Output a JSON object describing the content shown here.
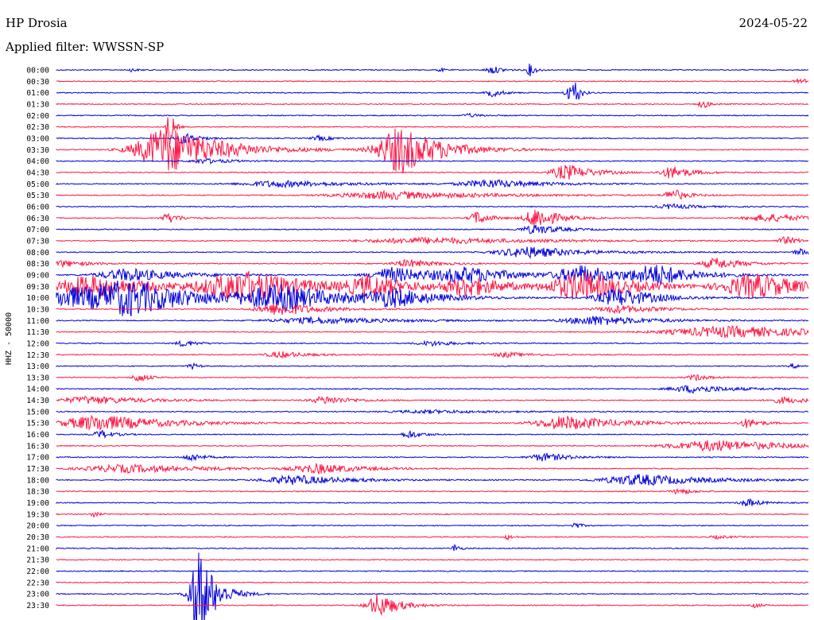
{
  "header": {
    "station": "HP Drosia",
    "date": "2024-05-22",
    "filter": "Applied filter: WWSSN-SP"
  },
  "chart_data": {
    "type": "line",
    "title": "HP Drosia",
    "ylabel": "HHZ - 50000",
    "colors": {
      "even": "#0000dd",
      "odd": "#ff1744"
    },
    "rows": [
      {
        "label": "00:00",
        "events": [
          {
            "t": 0.1,
            "a": 2,
            "w": 0.005
          },
          {
            "t": 0.51,
            "a": 3,
            "w": 0.003
          },
          {
            "t": 0.58,
            "a": 5,
            "w": 0.008
          },
          {
            "t": 0.63,
            "a": 8,
            "w": 0.004
          }
        ]
      },
      {
        "label": "00:30",
        "events": [
          {
            "t": 0.99,
            "a": 4,
            "w": 0.008
          }
        ]
      },
      {
        "label": "01:00",
        "events": [
          {
            "t": 0.58,
            "a": 5,
            "w": 0.008
          },
          {
            "t": 0.68,
            "a": 10,
            "w": 0.004
          },
          {
            "t": 0.69,
            "a": 14,
            "w": 0.004
          }
        ]
      },
      {
        "label": "01:30",
        "events": [
          {
            "t": 0.86,
            "a": 5,
            "w": 0.006
          }
        ]
      },
      {
        "label": "02:00",
        "events": [
          {
            "t": 0.55,
            "a": 2,
            "w": 0.01
          }
        ]
      },
      {
        "label": "02:30",
        "events": [
          {
            "t": 0.15,
            "a": 30,
            "w": 0.003
          }
        ]
      },
      {
        "label": "03:00",
        "events": [
          {
            "t": 0.17,
            "a": 8,
            "w": 0.01
          },
          {
            "t": 0.35,
            "a": 3,
            "w": 0.01
          }
        ]
      },
      {
        "label": "03:30",
        "events": [
          {
            "t": 0.15,
            "a": 30,
            "w": 0.04
          },
          {
            "t": 0.46,
            "a": 30,
            "w": 0.03
          }
        ]
      },
      {
        "label": "04:00",
        "events": [
          {
            "t": 0.2,
            "a": 3,
            "w": 0.02
          }
        ]
      },
      {
        "label": "04:30",
        "events": [
          {
            "t": 0.68,
            "a": 10,
            "w": 0.02
          },
          {
            "t": 0.82,
            "a": 8,
            "w": 0.015
          }
        ]
      },
      {
        "label": "05:00",
        "events": [
          {
            "t": 0.3,
            "a": 4,
            "w": 0.05
          },
          {
            "t": 0.58,
            "a": 5,
            "w": 0.04
          }
        ]
      },
      {
        "label": "05:30",
        "events": [
          {
            "t": 0.45,
            "a": 5,
            "w": 0.07
          },
          {
            "t": 0.82,
            "a": 8,
            "w": 0.01
          }
        ]
      },
      {
        "label": "06:00",
        "events": [
          {
            "t": 0.82,
            "a": 3,
            "w": 0.02
          }
        ]
      },
      {
        "label": "06:30",
        "events": [
          {
            "t": 0.15,
            "a": 6,
            "w": 0.01
          },
          {
            "t": 0.56,
            "a": 8,
            "w": 0.01
          },
          {
            "t": 0.64,
            "a": 14,
            "w": 0.015
          },
          {
            "t": 0.95,
            "a": 5,
            "w": 0.03
          }
        ]
      },
      {
        "label": "07:00",
        "events": [
          {
            "t": 0.64,
            "a": 6,
            "w": 0.02
          }
        ]
      },
      {
        "label": "07:30",
        "events": [
          {
            "t": 0.5,
            "a": 4,
            "w": 0.08
          },
          {
            "t": 0.97,
            "a": 5,
            "w": 0.01
          }
        ]
      },
      {
        "label": "08:00",
        "events": [
          {
            "t": 0.63,
            "a": 7,
            "w": 0.04
          },
          {
            "t": 0.99,
            "a": 4,
            "w": 0.01
          }
        ]
      },
      {
        "label": "08:30",
        "events": [
          {
            "t": 0.01,
            "a": 4,
            "w": 0.02
          },
          {
            "t": 0.47,
            "a": 5,
            "w": 0.02
          },
          {
            "t": 0.88,
            "a": 7,
            "w": 0.02
          }
        ]
      },
      {
        "label": "09:00",
        "events": [
          {
            "t": 0.1,
            "a": 8,
            "w": 0.04
          },
          {
            "t": 0.45,
            "a": 10,
            "w": 0.03
          },
          {
            "t": 0.55,
            "a": 9,
            "w": 0.04
          },
          {
            "t": 0.7,
            "a": 12,
            "w": 0.03
          },
          {
            "t": 0.8,
            "a": 12,
            "w": 0.03
          }
        ]
      },
      {
        "label": "09:30",
        "events": [
          {
            "t": 0.05,
            "a": 14,
            "w": 0.05
          },
          {
            "t": 0.25,
            "a": 20,
            "w": 0.05
          },
          {
            "t": 0.42,
            "a": 12,
            "w": 0.03
          },
          {
            "t": 0.55,
            "a": 12,
            "w": 0.03
          },
          {
            "t": 0.7,
            "a": 18,
            "w": 0.04
          },
          {
            "t": 0.93,
            "a": 16,
            "w": 0.04
          }
        ]
      },
      {
        "label": "10:00",
        "events": [
          {
            "t": 0.02,
            "a": 12,
            "w": 0.04
          },
          {
            "t": 0.1,
            "a": 20,
            "w": 0.05
          },
          {
            "t": 0.3,
            "a": 15,
            "w": 0.05
          },
          {
            "t": 0.45,
            "a": 10,
            "w": 0.03
          },
          {
            "t": 0.75,
            "a": 12,
            "w": 0.03
          }
        ]
      },
      {
        "label": "10:30",
        "events": [
          {
            "t": 0.3,
            "a": 8,
            "w": 0.03
          },
          {
            "t": 0.75,
            "a": 5,
            "w": 0.03
          }
        ]
      },
      {
        "label": "11:00",
        "events": [
          {
            "t": 0.35,
            "a": 4,
            "w": 0.06
          },
          {
            "t": 0.72,
            "a": 6,
            "w": 0.04
          }
        ]
      },
      {
        "label": "11:30",
        "events": [
          {
            "t": 0.9,
            "a": 7,
            "w": 0.08
          }
        ]
      },
      {
        "label": "12:00",
        "events": [
          {
            "t": 0.17,
            "a": 4,
            "w": 0.01
          },
          {
            "t": 0.5,
            "a": 3,
            "w": 0.02
          }
        ]
      },
      {
        "label": "12:30",
        "events": [
          {
            "t": 0.3,
            "a": 4,
            "w": 0.02
          },
          {
            "t": 0.6,
            "a": 3,
            "w": 0.02
          }
        ]
      },
      {
        "label": "13:00",
        "events": [
          {
            "t": 0.18,
            "a": 4,
            "w": 0.005
          },
          {
            "t": 0.98,
            "a": 3,
            "w": 0.005
          }
        ]
      },
      {
        "label": "13:30",
        "events": [
          {
            "t": 0.11,
            "a": 6,
            "w": 0.008
          },
          {
            "t": 0.85,
            "a": 4,
            "w": 0.01
          }
        ]
      },
      {
        "label": "14:00",
        "events": [
          {
            "t": 0.85,
            "a": 5,
            "w": 0.03
          }
        ]
      },
      {
        "label": "14:30",
        "events": [
          {
            "t": 0.05,
            "a": 5,
            "w": 0.04
          },
          {
            "t": 0.36,
            "a": 5,
            "w": 0.02
          },
          {
            "t": 0.97,
            "a": 4,
            "w": 0.02
          }
        ]
      },
      {
        "label": "15:00",
        "events": [
          {
            "t": 0.5,
            "a": 2,
            "w": 0.05
          }
        ]
      },
      {
        "label": "15:30",
        "events": [
          {
            "t": 0.06,
            "a": 10,
            "w": 0.05
          },
          {
            "t": 0.68,
            "a": 9,
            "w": 0.04
          },
          {
            "t": 0.92,
            "a": 6,
            "w": 0.01
          }
        ]
      },
      {
        "label": "16:00",
        "events": [
          {
            "t": 0.06,
            "a": 5,
            "w": 0.01
          },
          {
            "t": 0.47,
            "a": 5,
            "w": 0.01
          }
        ]
      },
      {
        "label": "16:30",
        "events": [
          {
            "t": 0.88,
            "a": 7,
            "w": 0.06
          }
        ]
      },
      {
        "label": "17:00",
        "events": [
          {
            "t": 0.18,
            "a": 5,
            "w": 0.01
          },
          {
            "t": 0.65,
            "a": 5,
            "w": 0.02
          }
        ]
      },
      {
        "label": "17:30",
        "events": [
          {
            "t": 0.1,
            "a": 5,
            "w": 0.06
          },
          {
            "t": 0.35,
            "a": 6,
            "w": 0.03
          }
        ]
      },
      {
        "label": "18:00",
        "events": [
          {
            "t": 0.32,
            "a": 6,
            "w": 0.04
          },
          {
            "t": 0.78,
            "a": 7,
            "w": 0.05
          }
        ]
      },
      {
        "label": "18:30",
        "events": [
          {
            "t": 0.83,
            "a": 4,
            "w": 0.01
          }
        ]
      },
      {
        "label": "19:00",
        "events": [
          {
            "t": 0.92,
            "a": 5,
            "w": 0.01
          }
        ]
      },
      {
        "label": "19:30",
        "events": [
          {
            "t": 0.05,
            "a": 3,
            "w": 0.005
          }
        ]
      },
      {
        "label": "20:00",
        "events": [
          {
            "t": 0.69,
            "a": 4,
            "w": 0.005
          }
        ]
      },
      {
        "label": "20:30",
        "events": [
          {
            "t": 0.6,
            "a": 3,
            "w": 0.005
          },
          {
            "t": 0.88,
            "a": 2,
            "w": 0.01
          }
        ]
      },
      {
        "label": "21:00",
        "events": [
          {
            "t": 0.53,
            "a": 5,
            "w": 0.004
          }
        ]
      },
      {
        "label": "21:30",
        "events": []
      },
      {
        "label": "22:00",
        "events": []
      },
      {
        "label": "22:30",
        "events": []
      },
      {
        "label": "23:00",
        "events": [
          {
            "t": 0.19,
            "a": 60,
            "w": 0.012
          }
        ]
      },
      {
        "label": "23:30",
        "events": [
          {
            "t": 0.43,
            "a": 15,
            "w": 0.015
          },
          {
            "t": 0.93,
            "a": 3,
            "w": 0.005
          }
        ]
      }
    ]
  }
}
